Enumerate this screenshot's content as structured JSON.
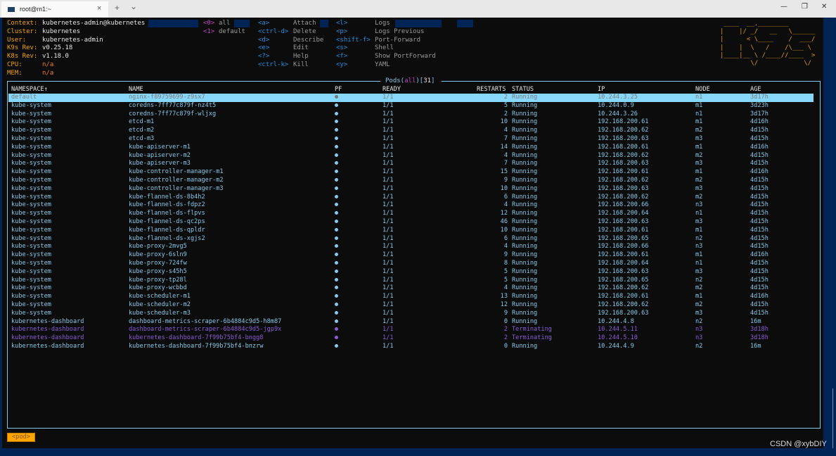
{
  "window": {
    "tab_title": "root@m1:~",
    "new_tab": "+",
    "tab_dropdown": "⌄",
    "tab_close": "×",
    "minimize": "—",
    "maximize": "❐",
    "close": "✕"
  },
  "cluster_info": [
    {
      "label": "Context:",
      "value": "kubernetes-admin@kubernetes",
      "kind": "normal"
    },
    {
      "label": "Cluster:",
      "value": "kubernetes",
      "kind": "normal"
    },
    {
      "label": "User:",
      "value": "kubernetes-admin",
      "kind": "normal"
    },
    {
      "label": "K9s Rev:",
      "value": "v0.25.18",
      "kind": "normal"
    },
    {
      "label": "K8s Rev:",
      "value": "v1.18.0",
      "kind": "normal"
    },
    {
      "label": "CPU:",
      "value": "n/a",
      "kind": "na"
    },
    {
      "label": "MEM:",
      "value": "n/a",
      "kind": "na"
    }
  ],
  "namespaces": [
    {
      "key": "<0>",
      "label": "all"
    },
    {
      "key": "<1>",
      "label": "default"
    }
  ],
  "hotkeys_col1": [
    {
      "key": "<a>",
      "label": "Attach"
    },
    {
      "key": "<ctrl-d>",
      "label": "Delete"
    },
    {
      "key": "<d>",
      "label": "Describe"
    },
    {
      "key": "<e>",
      "label": "Edit"
    },
    {
      "key": "<?>",
      "label": "Help"
    },
    {
      "key": "<ctrl-k>",
      "label": "Kill"
    }
  ],
  "hotkeys_col2": [
    {
      "key": "<l>",
      "label": "Logs"
    },
    {
      "key": "<p>",
      "label": "Logs Previous"
    },
    {
      "key": "<shift-f>",
      "label": "Port-Forward"
    },
    {
      "key": "<s>",
      "label": "Shell"
    },
    {
      "key": "<f>",
      "label": "Show PortForward"
    },
    {
      "key": "<y>",
      "label": "YAML"
    }
  ],
  "logo_lines": [
    " ____  __.________       ",
    "|    |/ _/   __   \\______",
    "|      < \\____    /  ___/",
    "|    |  \\   /    /\\___ \\ ",
    "|____|__ \\ /____//____  >",
    "        \\/            \\/ "
  ],
  "table": {
    "title_prefix": "Pods(",
    "title_filter": "all",
    "title_mid": ")[",
    "title_count": "31",
    "title_suffix": "]",
    "headers": {
      "namespace": "NAMESPACE↑",
      "name": "NAME",
      "pf": "PF",
      "ready": "READY",
      "restarts": "RESTARTS",
      "status": "STATUS",
      "ip": "IP",
      "node": "NODE",
      "age": "AGE"
    },
    "rows": [
      {
        "namespace": "default",
        "name": "nginx-f89759699-z9sx7",
        "pf": "●",
        "ready": "1/1",
        "restarts": "2",
        "status": "Running",
        "ip": "10.244.3.25",
        "node": "n1",
        "age": "3d17h",
        "selected": true
      },
      {
        "namespace": "kube-system",
        "name": "coredns-7ff77c879f-nz4t5",
        "pf": "●",
        "ready": "1/1",
        "restarts": "5",
        "status": "Running",
        "ip": "10.244.0.9",
        "node": "m1",
        "age": "3d23h"
      },
      {
        "namespace": "kube-system",
        "name": "coredns-7ff77c879f-wljxg",
        "pf": "●",
        "ready": "1/1",
        "restarts": "2",
        "status": "Running",
        "ip": "10.244.3.26",
        "node": "n1",
        "age": "3d17h"
      },
      {
        "namespace": "kube-system",
        "name": "etcd-m1",
        "pf": "●",
        "ready": "1/1",
        "restarts": "10",
        "status": "Running",
        "ip": "192.168.200.61",
        "node": "m1",
        "age": "4d16h"
      },
      {
        "namespace": "kube-system",
        "name": "etcd-m2",
        "pf": "●",
        "ready": "1/1",
        "restarts": "4",
        "status": "Running",
        "ip": "192.168.200.62",
        "node": "m2",
        "age": "4d15h"
      },
      {
        "namespace": "kube-system",
        "name": "etcd-m3",
        "pf": "●",
        "ready": "1/1",
        "restarts": "7",
        "status": "Running",
        "ip": "192.168.200.63",
        "node": "m3",
        "age": "4d15h"
      },
      {
        "namespace": "kube-system",
        "name": "kube-apiserver-m1",
        "pf": "●",
        "ready": "1/1",
        "restarts": "14",
        "status": "Running",
        "ip": "192.168.200.61",
        "node": "m1",
        "age": "4d16h"
      },
      {
        "namespace": "kube-system",
        "name": "kube-apiserver-m2",
        "pf": "●",
        "ready": "1/1",
        "restarts": "4",
        "status": "Running",
        "ip": "192.168.200.62",
        "node": "m2",
        "age": "4d15h"
      },
      {
        "namespace": "kube-system",
        "name": "kube-apiserver-m3",
        "pf": "●",
        "ready": "1/1",
        "restarts": "7",
        "status": "Running",
        "ip": "192.168.200.63",
        "node": "m3",
        "age": "4d15h"
      },
      {
        "namespace": "kube-system",
        "name": "kube-controller-manager-m1",
        "pf": "●",
        "ready": "1/1",
        "restarts": "15",
        "status": "Running",
        "ip": "192.168.200.61",
        "node": "m1",
        "age": "4d16h"
      },
      {
        "namespace": "kube-system",
        "name": "kube-controller-manager-m2",
        "pf": "●",
        "ready": "1/1",
        "restarts": "9",
        "status": "Running",
        "ip": "192.168.200.62",
        "node": "m2",
        "age": "4d15h"
      },
      {
        "namespace": "kube-system",
        "name": "kube-controller-manager-m3",
        "pf": "●",
        "ready": "1/1",
        "restarts": "10",
        "status": "Running",
        "ip": "192.168.200.63",
        "node": "m3",
        "age": "4d15h"
      },
      {
        "namespace": "kube-system",
        "name": "kube-flannel-ds-8b4h2",
        "pf": "●",
        "ready": "1/1",
        "restarts": "6",
        "status": "Running",
        "ip": "192.168.200.62",
        "node": "m2",
        "age": "4d15h"
      },
      {
        "namespace": "kube-system",
        "name": "kube-flannel-ds-fdpz2",
        "pf": "●",
        "ready": "1/1",
        "restarts": "4",
        "status": "Running",
        "ip": "192.168.200.66",
        "node": "n3",
        "age": "4d15h"
      },
      {
        "namespace": "kube-system",
        "name": "kube-flannel-ds-flpvs",
        "pf": "●",
        "ready": "1/1",
        "restarts": "12",
        "status": "Running",
        "ip": "192.168.200.64",
        "node": "n1",
        "age": "4d15h"
      },
      {
        "namespace": "kube-system",
        "name": "kube-flannel-ds-qc2ps",
        "pf": "●",
        "ready": "1/1",
        "restarts": "46",
        "status": "Running",
        "ip": "192.168.200.63",
        "node": "m3",
        "age": "4d15h"
      },
      {
        "namespace": "kube-system",
        "name": "kube-flannel-ds-qpldr",
        "pf": "●",
        "ready": "1/1",
        "restarts": "10",
        "status": "Running",
        "ip": "192.168.200.61",
        "node": "m1",
        "age": "4d15h"
      },
      {
        "namespace": "kube-system",
        "name": "kube-flannel-ds-xgjs2",
        "pf": "●",
        "ready": "1/1",
        "restarts": "6",
        "status": "Running",
        "ip": "192.168.200.65",
        "node": "n2",
        "age": "4d15h"
      },
      {
        "namespace": "kube-system",
        "name": "kube-proxy-2mvg5",
        "pf": "●",
        "ready": "1/1",
        "restarts": "4",
        "status": "Running",
        "ip": "192.168.200.66",
        "node": "n3",
        "age": "4d15h"
      },
      {
        "namespace": "kube-system",
        "name": "kube-proxy-6sln9",
        "pf": "●",
        "ready": "1/1",
        "restarts": "9",
        "status": "Running",
        "ip": "192.168.200.61",
        "node": "m1",
        "age": "4d16h"
      },
      {
        "namespace": "kube-system",
        "name": "kube-proxy-724fw",
        "pf": "●",
        "ready": "1/1",
        "restarts": "8",
        "status": "Running",
        "ip": "192.168.200.64",
        "node": "n1",
        "age": "4d15h"
      },
      {
        "namespace": "kube-system",
        "name": "kube-proxy-s45h5",
        "pf": "●",
        "ready": "1/1",
        "restarts": "5",
        "status": "Running",
        "ip": "192.168.200.63",
        "node": "m3",
        "age": "4d15h"
      },
      {
        "namespace": "kube-system",
        "name": "kube-proxy-tp28l",
        "pf": "●",
        "ready": "1/1",
        "restarts": "5",
        "status": "Running",
        "ip": "192.168.200.65",
        "node": "n2",
        "age": "4d15h"
      },
      {
        "namespace": "kube-system",
        "name": "kube-proxy-wcbbd",
        "pf": "●",
        "ready": "1/1",
        "restarts": "4",
        "status": "Running",
        "ip": "192.168.200.62",
        "node": "m2",
        "age": "4d15h"
      },
      {
        "namespace": "kube-system",
        "name": "kube-scheduler-m1",
        "pf": "●",
        "ready": "1/1",
        "restarts": "13",
        "status": "Running",
        "ip": "192.168.200.61",
        "node": "m1",
        "age": "4d16h"
      },
      {
        "namespace": "kube-system",
        "name": "kube-scheduler-m2",
        "pf": "●",
        "ready": "1/1",
        "restarts": "12",
        "status": "Running",
        "ip": "192.168.200.62",
        "node": "m2",
        "age": "4d15h"
      },
      {
        "namespace": "kube-system",
        "name": "kube-scheduler-m3",
        "pf": "●",
        "ready": "1/1",
        "restarts": "9",
        "status": "Running",
        "ip": "192.168.200.63",
        "node": "m3",
        "age": "4d15h"
      },
      {
        "namespace": "kubernetes-dashboard",
        "name": "dashboard-metrics-scraper-6b4884c9d5-h8m87",
        "pf": "●",
        "ready": "1/1",
        "restarts": "0",
        "status": "Running",
        "ip": "10.244.4.8",
        "node": "n2",
        "age": "16m"
      },
      {
        "namespace": "kubernetes-dashboard",
        "name": "dashboard-metrics-scraper-6b4884c9d5-jgp9x",
        "pf": "●",
        "ready": "1/1",
        "restarts": "2",
        "status": "Terminating",
        "ip": "10.244.5.11",
        "node": "n3",
        "age": "3d18h"
      },
      {
        "namespace": "kubernetes-dashboard",
        "name": "kubernetes-dashboard-7f99b75bf4-bngg8",
        "pf": "●",
        "ready": "1/1",
        "restarts": "2",
        "status": "Terminating",
        "ip": "10.244.5.10",
        "node": "n3",
        "age": "3d18h"
      },
      {
        "namespace": "kubernetes-dashboard",
        "name": "kubernetes-dashboard-7f99b75bf4-bnzrw",
        "pf": "●",
        "ready": "1/1",
        "restarts": "0",
        "status": "Running",
        "ip": "10.244.4.9",
        "node": "n2",
        "age": "16m"
      }
    ]
  },
  "breadcrumb": "<pod>",
  "watermark": "CSDN @xybDIY",
  "colors": {
    "running": "#87c9ea",
    "terminating": "#8a5bd6",
    "selected_bg": "#87d7fb",
    "label": "#f0a30a",
    "hotkey": "#1f8fe0",
    "namespace_key": "#c040c0",
    "logo": "#e09b10",
    "breadcrumb_bg": "#ffa500",
    "frame": "#87c9ea"
  }
}
